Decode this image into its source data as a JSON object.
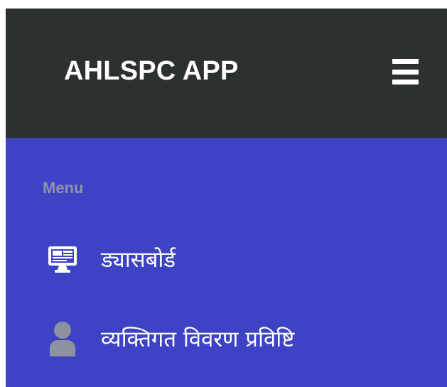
{
  "header": {
    "title": "AHLSPC APP",
    "menu_toggle_icon": "hamburger-icon"
  },
  "sidebar": {
    "heading": "Menu",
    "items": [
      {
        "label": "ड्यासबोर्ड",
        "icon": "monitor-icon"
      },
      {
        "label": "व्यक्तिगत विवरण प्रविष्टि",
        "icon": "user-icon"
      }
    ]
  },
  "colors": {
    "header_bg": "#2c302e",
    "sidebar_bg": "#3e43c6",
    "heading_text": "#8f93a8",
    "user_icon": "#8d929f",
    "text": "#ffffff"
  }
}
